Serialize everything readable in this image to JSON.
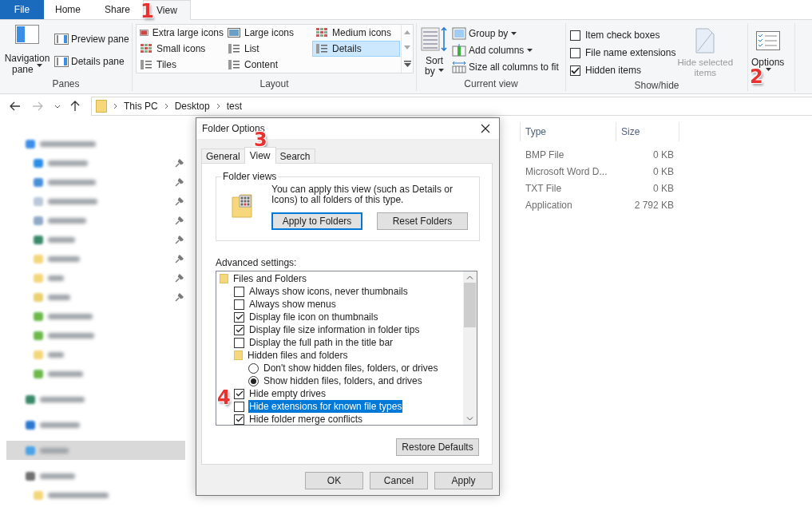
{
  "ribbon": {
    "tabs": [
      {
        "label": "File",
        "kind": "file",
        "selected": false
      },
      {
        "label": "Home",
        "kind": "tab",
        "selected": false
      },
      {
        "label": "Share",
        "kind": "tab",
        "selected": false
      },
      {
        "label": "View",
        "kind": "tab",
        "selected": true
      }
    ],
    "panes": {
      "title": "Panes",
      "navigation": [
        "Navigation",
        "pane"
      ],
      "items": [
        "Preview pane",
        "Details pane"
      ]
    },
    "layout": {
      "title": "Layout",
      "items": [
        {
          "label": "Extra large icons",
          "kind": "xl",
          "selected": false
        },
        {
          "label": "Large icons",
          "kind": "large",
          "selected": false
        },
        {
          "label": "Medium icons",
          "kind": "medium",
          "selected": false
        },
        {
          "label": "Small icons",
          "kind": "small",
          "selected": false
        },
        {
          "label": "List",
          "kind": "list",
          "selected": false
        },
        {
          "label": "Details",
          "kind": "details",
          "selected": true
        },
        {
          "label": "Tiles",
          "kind": "tiles",
          "selected": false
        },
        {
          "label": "Content",
          "kind": "content",
          "selected": false
        }
      ]
    },
    "current_view": {
      "title": "Current view",
      "sort": [
        "Sort",
        "by"
      ],
      "items": [
        {
          "label": "Group by",
          "kind": "group",
          "dropdown": true
        },
        {
          "label": "Add columns",
          "kind": "columns",
          "dropdown": true
        },
        {
          "label": "Size all columns to fit",
          "kind": "fit",
          "dropdown": false
        }
      ]
    },
    "show_hide": {
      "title": "Show/hide",
      "checks": [
        {
          "label": "Item check boxes",
          "checked": false
        },
        {
          "label": "File name extensions",
          "checked": false
        },
        {
          "label": "Hidden items",
          "checked": true
        }
      ],
      "hide_selected": {
        "label": [
          "Hide selected",
          "items"
        ],
        "disabled": true
      }
    },
    "options": {
      "label": "Options"
    }
  },
  "address": {
    "crumbs": [
      "This PC",
      "Desktop",
      "test"
    ]
  },
  "sidebar": {
    "items": [
      {
        "kind": "quick",
        "pinned": false,
        "selected": false,
        "children": [
          {
            "kind": "desktop",
            "pinned": true,
            "selected": false
          },
          {
            "kind": "download",
            "pinned": true,
            "selected": false
          },
          {
            "kind": "document",
            "pinned": true,
            "selected": false
          },
          {
            "kind": "picture",
            "pinned": true,
            "selected": false
          },
          {
            "kind": "globe",
            "pinned": true,
            "selected": false
          },
          {
            "kind": "folder",
            "pinned": true,
            "selected": false
          },
          {
            "kind": "folder",
            "pinned": true,
            "selected": false
          },
          {
            "kind": "folder_net",
            "pinned": true,
            "selected": false
          },
          {
            "kind": "folder_green",
            "pinned": false,
            "selected": false
          },
          {
            "kind": "folder_green",
            "pinned": false,
            "selected": false
          },
          {
            "kind": "folder",
            "pinned": false,
            "selected": false
          },
          {
            "kind": "folder_green",
            "pinned": false,
            "selected": false
          }
        ]
      },
      {
        "kind": "globe",
        "pinned": false,
        "selected": false
      },
      {
        "kind": "cloud",
        "pinned": false,
        "selected": false
      },
      {
        "kind": "pc",
        "pinned": false,
        "selected": true
      },
      {
        "kind": "drive",
        "pinned": false,
        "selected": false,
        "children": [
          {
            "kind": "folder",
            "pinned": false,
            "selected": false
          }
        ]
      }
    ]
  },
  "files": {
    "columns": [
      "Type",
      "Size"
    ],
    "rows": [
      {
        "type": "BMP File",
        "size": "0 KB"
      },
      {
        "type": "Microsoft Word D...",
        "size": "0 KB"
      },
      {
        "type": "TXT File",
        "size": "0 KB"
      },
      {
        "type": "Application",
        "size": "2 792 KB"
      }
    ]
  },
  "dialog": {
    "title": "Folder Options",
    "tabs": [
      {
        "label": "General",
        "selected": false
      },
      {
        "label": "View",
        "selected": true
      },
      {
        "label": "Search",
        "selected": false
      }
    ],
    "folder_views": {
      "title": "Folder views",
      "text": "You can apply this view (such as Details or Icons) to all folders of this type.",
      "buttons": [
        {
          "label": "Apply to Folders",
          "default": true
        },
        {
          "label": "Reset Folders",
          "default": false
        }
      ]
    },
    "advanced_label": "Advanced settings:",
    "settings": [
      {
        "kind": "group",
        "label": "Files and Folders",
        "selected": false,
        "children": [
          {
            "kind": "checkbox",
            "label": "Always show icons, never thumbnails",
            "checked": false,
            "selected": false
          },
          {
            "kind": "checkbox",
            "label": "Always show menus",
            "checked": false,
            "selected": false
          },
          {
            "kind": "checkbox",
            "label": "Display file icon on thumbnails",
            "checked": true,
            "selected": false
          },
          {
            "kind": "checkbox",
            "label": "Display file size information in folder tips",
            "checked": true,
            "selected": false
          },
          {
            "kind": "checkbox",
            "label": "Display the full path in the title bar",
            "checked": false,
            "selected": false
          },
          {
            "kind": "group",
            "label": "Hidden files and folders",
            "selected": false,
            "children": [
              {
                "kind": "radio",
                "label": "Don't show hidden files, folders, or drives",
                "checked": false,
                "selected": false
              },
              {
                "kind": "radio",
                "label": "Show hidden files, folders, and drives",
                "checked": true,
                "selected": false
              }
            ]
          },
          {
            "kind": "checkbox",
            "label": "Hide empty drives",
            "checked": true,
            "selected": false
          },
          {
            "kind": "checkbox",
            "label": "Hide extensions for known file types",
            "checked": false,
            "selected": true
          },
          {
            "kind": "checkbox",
            "label": "Hide folder merge conflicts",
            "checked": true,
            "selected": false
          }
        ]
      }
    ],
    "restore": "Restore Defaults",
    "buttons": [
      "OK",
      "Cancel",
      "Apply"
    ]
  },
  "annotations": [
    "1",
    "2",
    "3",
    "4"
  ]
}
